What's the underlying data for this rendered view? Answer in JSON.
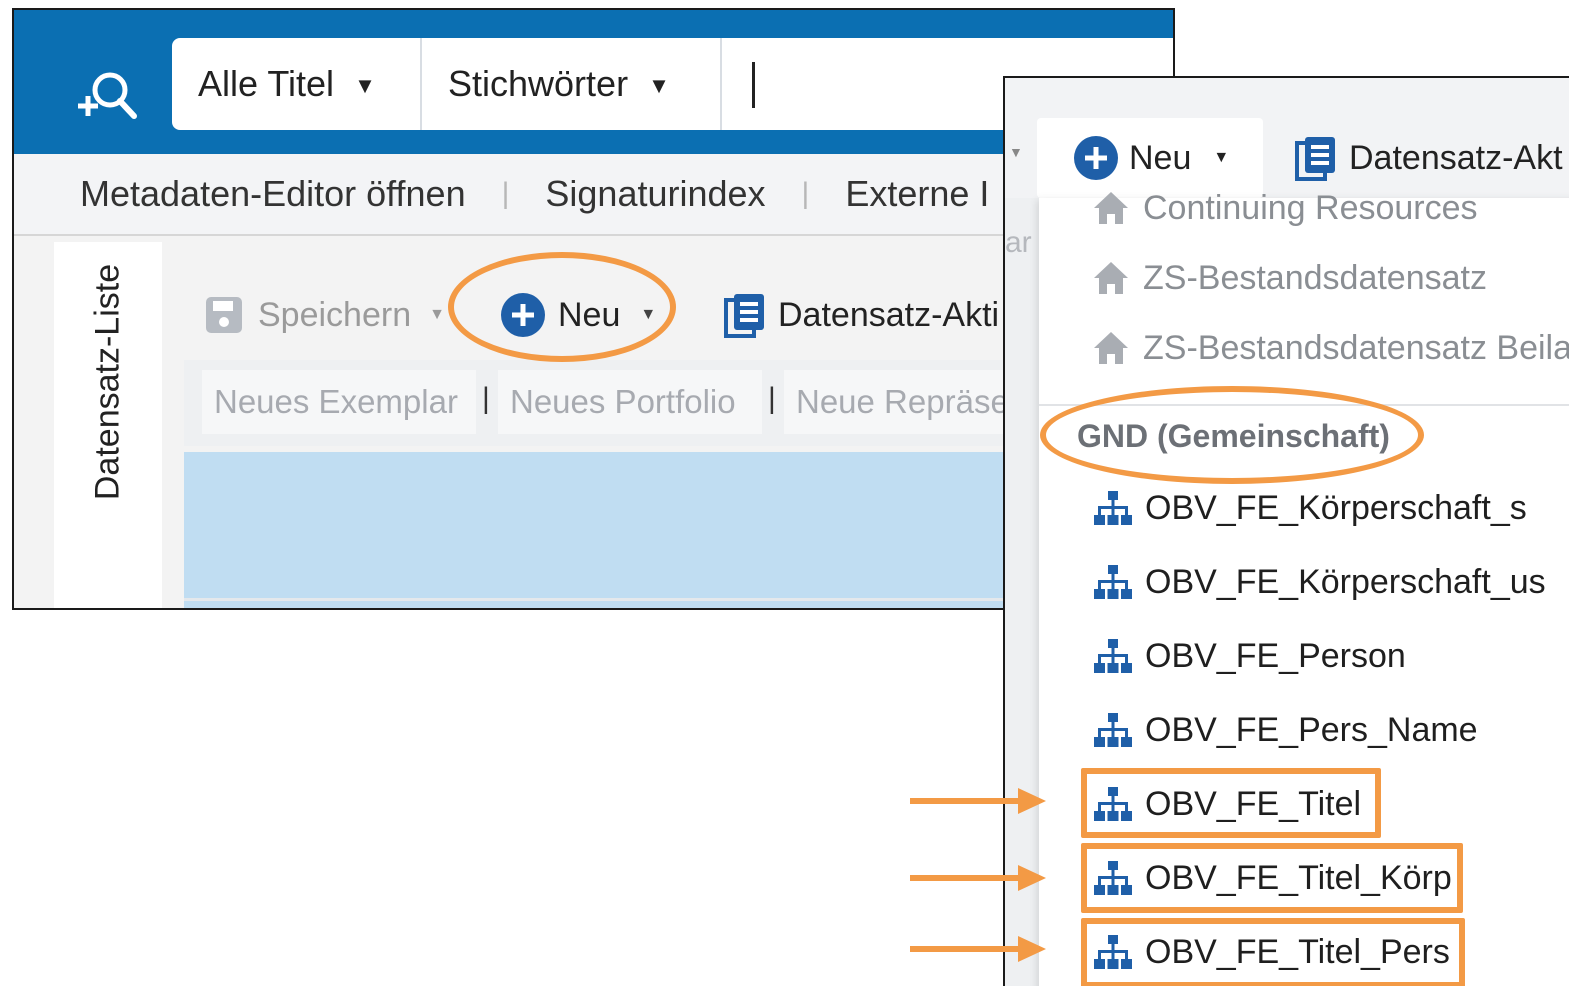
{
  "search": {
    "scope_title": "Alle Titel",
    "scope_keyword": "Stichwörter"
  },
  "quicklinks": {
    "item1": "Metadaten-Editor öffnen",
    "item2": "Signaturindex",
    "item3": "Externe I"
  },
  "side_panel": {
    "label": "Datensatz-Liste"
  },
  "toolbar": {
    "save_label": "Speichern",
    "new_label": "Neu",
    "actions_label": "Datensatz-Akti"
  },
  "subtabs": {
    "tab1": "Neues Exemplar",
    "tab2": "Neues Portfolio",
    "tab3": "Neue Repräse",
    "separator": "|"
  },
  "popup": {
    "new_label": "Neu",
    "actions_label": "Datensatz-Akt",
    "clipped_left_text": "ar",
    "home_items": [
      "Continuing Resources",
      "ZS-Bestandsdatensatz",
      "ZS-Bestandsdatensatz Beila"
    ],
    "section_header": "GND (Gemeinschaft)",
    "gnd_items": [
      "OBV_FE_Körperschaft_s",
      "OBV_FE_Körperschaft_us",
      "OBV_FE_Person",
      "OBV_FE_Pers_Name",
      "OBV_FE_Titel",
      "OBV_FE_Titel_Körp",
      "OBV_FE_Titel_Pers"
    ]
  },
  "colors": {
    "topbar": "#0b6fb2",
    "accent_blue": "#1f5fa8",
    "annotation_orange": "#f39a45",
    "result_highlight": "#c0ddf2"
  }
}
